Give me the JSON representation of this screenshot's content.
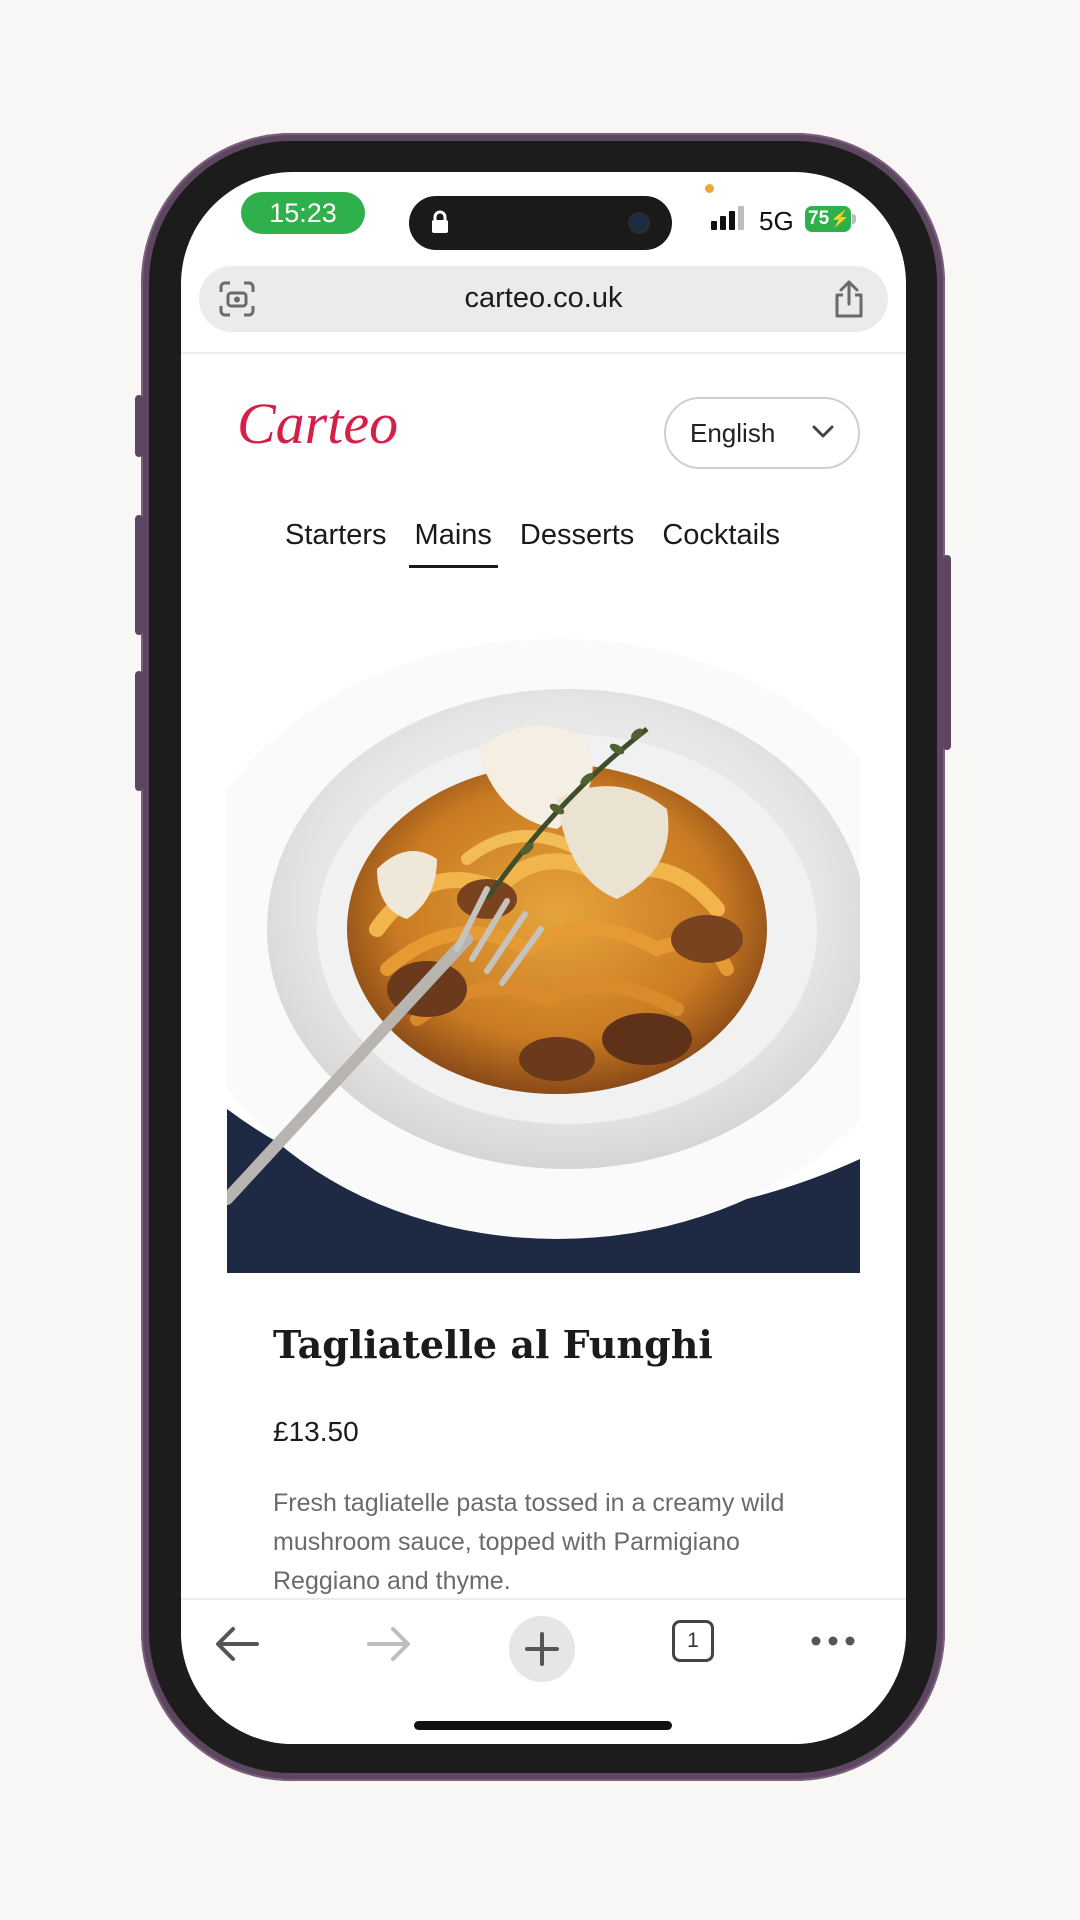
{
  "status_bar": {
    "time": "15:23",
    "network": "5G",
    "battery": "75"
  },
  "browser": {
    "url": "carteo.co.uk",
    "open_tabs": "1"
  },
  "site": {
    "logo": "Carteo",
    "language": "English",
    "categories": [
      {
        "label": "Starters",
        "active": false
      },
      {
        "label": "Mains",
        "active": true
      },
      {
        "label": "Desserts",
        "active": false
      },
      {
        "label": "Cocktails",
        "active": false
      }
    ]
  },
  "dish": {
    "name": "Tagliatelle al Funghi",
    "price": "£13.50",
    "description": "Fresh tagliatelle pasta tossed in a creamy wild mushroom sauce, topped with Parmigiano Reggiano and thyme."
  },
  "colors": {
    "brand": "#d61f48",
    "status_green": "#2fb04c",
    "phone_frame": "#5d4660"
  },
  "icons": {
    "scan": "scan-camera-icon",
    "share": "share-icon",
    "back": "back-arrow-icon",
    "forward": "forward-arrow-icon",
    "new_tab": "plus-icon",
    "tabs": "tabs-icon",
    "more": "more-dots-icon"
  }
}
